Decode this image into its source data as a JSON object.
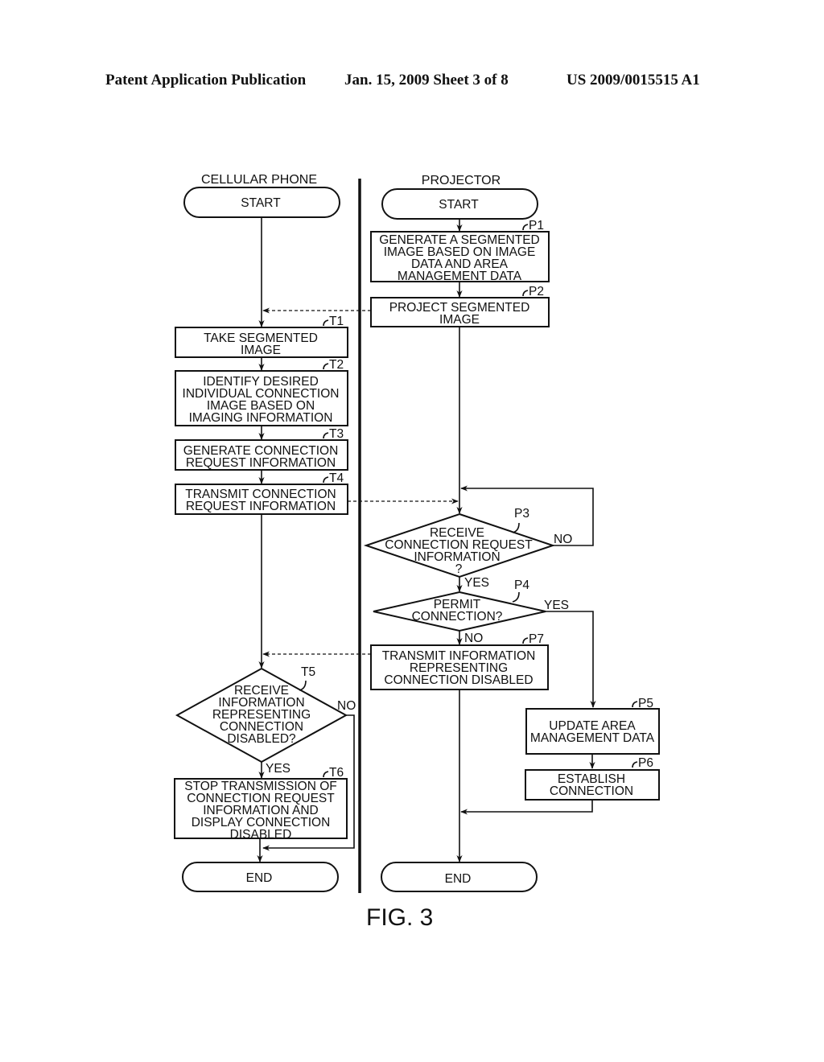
{
  "header": {
    "publication": "Patent Application Publication",
    "date_sheet": "Jan. 15, 2009  Sheet 3 of 8",
    "number": "US 2009/0015515 A1"
  },
  "lanes": {
    "left": "CELLULAR PHONE",
    "right": "PROJECTOR"
  },
  "terminals": {
    "left_start": "START",
    "right_start": "START",
    "left_end": "END",
    "right_end": "END"
  },
  "steps": {
    "P1": {
      "tag": "P1",
      "lines": [
        "GENERATE A SEGMENTED",
        "IMAGE BASED ON IMAGE",
        "DATA AND AREA",
        "MANAGEMENT DATA"
      ]
    },
    "P2": {
      "tag": "P2",
      "lines": [
        "PROJECT SEGMENTED",
        "IMAGE"
      ]
    },
    "P3": {
      "tag": "P3",
      "lines": [
        "RECEIVE",
        "CONNECTION REQUEST",
        "INFORMATION",
        "?"
      ]
    },
    "P4": {
      "tag": "P4",
      "lines": [
        "PERMIT",
        "CONNECTION?"
      ]
    },
    "P5": {
      "tag": "P5",
      "lines": [
        "UPDATE AREA",
        "MANAGEMENT DATA"
      ]
    },
    "P6": {
      "tag": "P6",
      "lines": [
        "ESTABLISH",
        "CONNECTION"
      ]
    },
    "P7": {
      "tag": "P7",
      "lines": [
        "TRANSMIT INFORMATION",
        "REPRESENTING",
        "CONNECTION DISABLED"
      ]
    },
    "T1": {
      "tag": "T1",
      "lines": [
        "TAKE SEGMENTED",
        "IMAGE"
      ]
    },
    "T2": {
      "tag": "T2",
      "lines": [
        "IDENTIFY DESIRED",
        "INDIVIDUAL CONNECTION",
        "IMAGE BASED ON",
        "IMAGING INFORMATION"
      ]
    },
    "T3": {
      "tag": "T3",
      "lines": [
        "GENERATE CONNECTION",
        "REQUEST INFORMATION"
      ]
    },
    "T4": {
      "tag": "T4",
      "lines": [
        "TRANSMIT CONNECTION",
        "REQUEST INFORMATION"
      ]
    },
    "T5": {
      "tag": "T5",
      "lines": [
        "RECEIVE",
        "INFORMATION",
        "REPRESENTING",
        "CONNECTION",
        "DISABLED?"
      ]
    },
    "T6": {
      "tag": "T6",
      "lines": [
        "STOP TRANSMISSION OF",
        "CONNECTION REQUEST",
        "INFORMATION AND",
        "DISPLAY CONNECTION",
        "DISABLED"
      ]
    }
  },
  "branches": {
    "p3_yes": "YES",
    "p3_no": "NO",
    "p4_yes": "YES",
    "p4_no": "NO",
    "t5_yes": "YES",
    "t5_no": "NO"
  },
  "caption": "FIG. 3"
}
